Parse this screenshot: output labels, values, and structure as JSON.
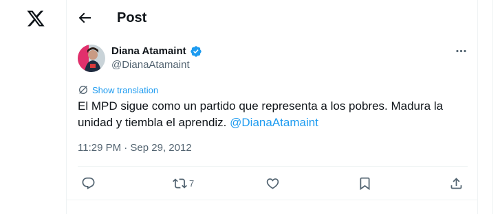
{
  "header": {
    "title": "Post"
  },
  "tweet": {
    "author_name": "Diana Atamaint",
    "author_handle": "@DianaAtamaint",
    "show_translation": "Show translation",
    "text_main": "El MPD sigue como un partido que representa a los pobres. Madura la unidad y tiembla el aprendiz. ",
    "mention": "@DianaAtamaint",
    "timestamp": "11:29 PM · Sep 29, 2012",
    "retweet_count": "7"
  },
  "colors": {
    "accent": "#1d9bf0",
    "muted": "#536471",
    "text": "#0f1419",
    "border": "#eff3f4"
  },
  "icons": [
    "x-logo-icon",
    "back-arrow-icon",
    "verified-badge-icon",
    "more-icon",
    "translate-icon",
    "reply-icon",
    "retweet-icon",
    "like-icon",
    "bookmark-icon",
    "share-icon"
  ]
}
